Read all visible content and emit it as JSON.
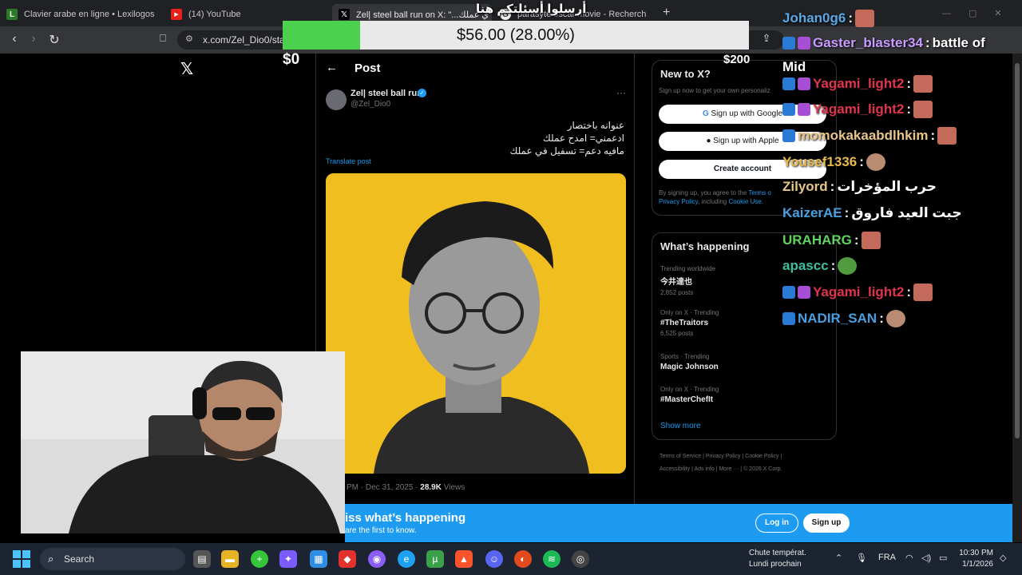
{
  "browser": {
    "tabs": [
      {
        "label": "Clavier arabe en ligne • Lexilogos",
        "icon": "lexilogos-icon"
      },
      {
        "label": "(14) YouTube",
        "icon": "youtube-icon"
      },
      {
        "label": "Zel| steel ball run on X: \"...ي عملك",
        "icon": "x-icon"
      },
      {
        "label": "parasyte oscar movie - Recherch",
        "icon": "search-icon"
      }
    ],
    "url": "x.com/Zel_Dio0/sta"
  },
  "stream_overlay": {
    "donation_text": "$56.00 (28.00%)",
    "donation_progress": 0.28,
    "goal_start": "$0",
    "goal_end": "$200",
    "top_arabic": "أرسلوا أسئلتكم هنا"
  },
  "x": {
    "post_header": "Post",
    "author_name": "Zel| steel ball run",
    "author_handle": "@Zel_Dio0",
    "text_lines": [
      "عنوانه باختصار",
      "ادعمني= امدح عملك",
      "مافيه دعم= تسفيل في عملك"
    ],
    "translate": "Translate post",
    "meta_time": "PM · Dec 31, 2025 · ",
    "meta_views": "28.9K",
    "meta_views_label": " Views",
    "new_to_x": {
      "title": "New to X?",
      "subtitle": "Sign up now to get your own personaliz",
      "google": "Sign up with Google",
      "apple": "Sign up with Apple",
      "create": "Create account",
      "legal_a": "By signing up, you agree to the ",
      "legal_terms": "Terms o",
      "legal_b": "Privacy Policy",
      "legal_c": ", including ",
      "legal_cookie": "Cookie Use."
    },
    "happening": {
      "title": "What’s happening",
      "items": [
        {
          "context": "Trending worldwide",
          "name": "今井達也",
          "posts": "2,852 posts"
        },
        {
          "context": "Only on X · Trending",
          "name": "#TheTraitors",
          "posts": "6,525 posts"
        },
        {
          "context": "Sports · Trending",
          "name": "Magic Johnson",
          "posts": ""
        },
        {
          "context": "Only on X · Trending",
          "name": "#MasterChefIt",
          "posts": ""
        }
      ],
      "show_more": "Show more"
    },
    "footer": [
      "Terms of Service",
      "Privacy Policy",
      "Cookie Policy",
      "Accessibility",
      "Ads info",
      "More ···",
      "© 2026 X Corp."
    ],
    "banner": {
      "headline": "iss what’s happening",
      "sub": "are the first to know.",
      "login": "Log in",
      "signup": "Sign up"
    }
  },
  "chat": [
    {
      "user": "Johan0g6",
      "color": "#5aa9e6",
      "msg": "",
      "emote": true
    },
    {
      "user": "Gaster_blaster34",
      "color": "#c79bff",
      "msg": "battle of",
      "cont": "Mid",
      "badges": 2
    },
    {
      "user": "Yagami_light2",
      "color": "#e0344c",
      "msg": "",
      "emote": true,
      "badges": 2
    },
    {
      "user": "Yagami_light2",
      "color": "#e0344c",
      "msg": "",
      "emote": true,
      "badges": 2
    },
    {
      "user": "momokakaabdlhkim",
      "color": "#e8c68a",
      "msg": "",
      "emote": true,
      "badges": 1
    },
    {
      "user": "Yousef1336",
      "color": "#e8b94a",
      "msg": "",
      "emote": true
    },
    {
      "user": "Zilyord",
      "color": "#e8c68a",
      "msg": "حرب المؤخرات"
    },
    {
      "user": "KaizerAE",
      "color": "#4a9fe0",
      "msg": "جبت العيد فاروق"
    },
    {
      "user": "URAHARG",
      "color": "#5fd35f",
      "msg": "",
      "emote": true
    },
    {
      "user": "apascc",
      "color": "#3fbf9f",
      "msg": "",
      "emote": true
    },
    {
      "user": "Yagami_light2",
      "color": "#e0344c",
      "msg": "",
      "emote": true,
      "badges": 2
    },
    {
      "user": "NADIR_SAN",
      "color": "#4a9fe0",
      "msg": "",
      "emote": true,
      "badges": 1
    }
  ],
  "taskbar": {
    "search": "Search",
    "weather_title": "Chute températ.",
    "weather_sub": "Lundi prochain",
    "lang": "FRA",
    "time": "10:30 PM",
    "date": "1/1/2026"
  },
  "colors": {
    "accent": "#1d9bf0",
    "progress": "#4cd14c"
  }
}
